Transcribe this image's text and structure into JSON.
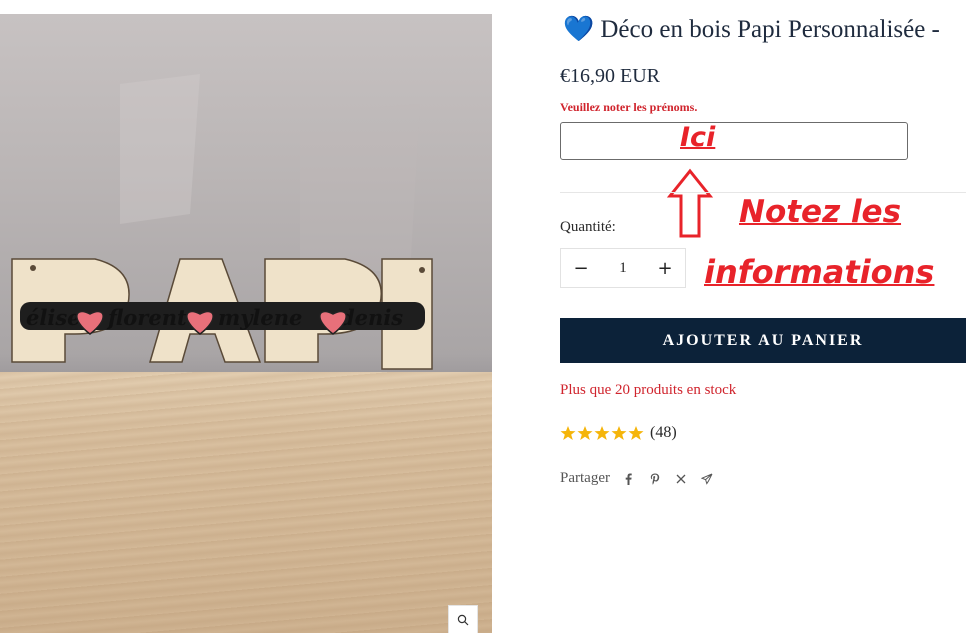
{
  "product": {
    "title": "💙 Déco en bois Papi Personnalisée -",
    "price": "€16,90 EUR",
    "note_label": "Veuillez noter les prénoms.",
    "note_value": "",
    "quantity_label": "Quantité:",
    "quantity_minus": "−",
    "quantity_value": "1",
    "quantity_plus": "+",
    "add_to_cart_label": "AJOUTER AU PANIER",
    "stock_text": "Plus que 20 produits en stock",
    "rating_stars": 5,
    "rating_count": "(48)",
    "share_label": "Partager"
  },
  "photo": {
    "letters": "PAPi",
    "names": [
      "élise",
      "florent",
      "mylene",
      "denis"
    ]
  },
  "annotations": {
    "ici": "Ici",
    "notez": "Notez les",
    "informations": "informations"
  },
  "icons": [
    "zoom-icon",
    "facebook-icon",
    "pinterest-icon",
    "x-icon",
    "send-icon"
  ],
  "colors": {
    "accent_red": "#d0242d",
    "button_navy": "#0c2239",
    "annotation_red": "#e8232a",
    "star_gold": "#f5b50a"
  }
}
